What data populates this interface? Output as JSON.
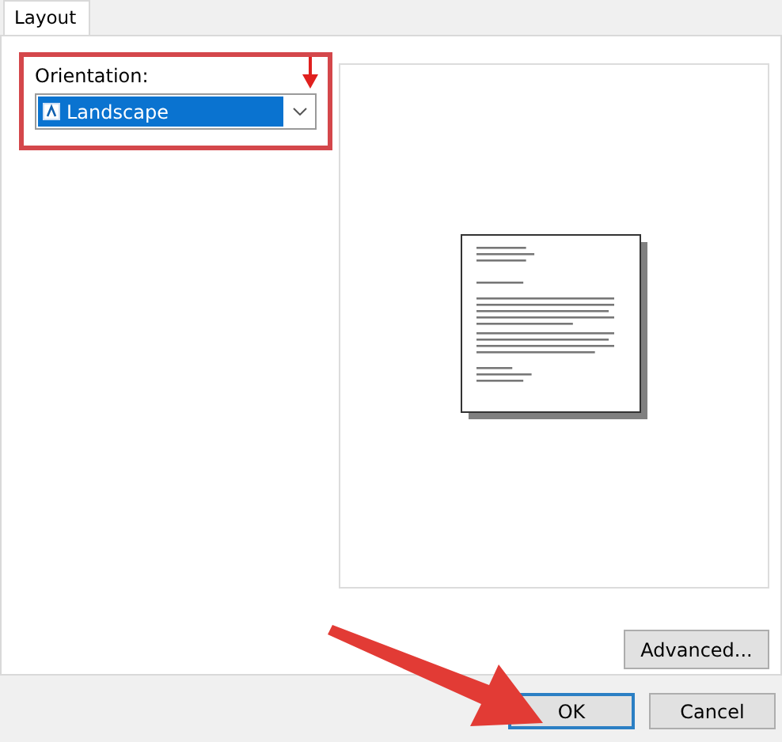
{
  "tabs": [
    {
      "label": "Layout",
      "selected": true
    }
  ],
  "orientation": {
    "label": "Orientation:",
    "value": "Landscape",
    "highlighted": true
  },
  "advanced_button": "Advanced...",
  "buttons": [
    {
      "label": "OK",
      "default": true
    },
    {
      "label": "Cancel",
      "default": false
    }
  ]
}
